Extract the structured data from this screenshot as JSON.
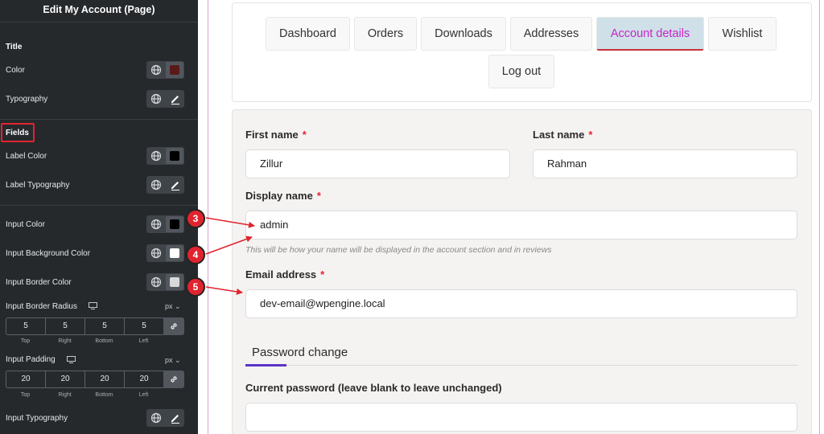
{
  "editor": {
    "title": "Edit My Account (Page)",
    "title_section": "Title",
    "title_color_label": "Color",
    "title_color": "#5a1a1a",
    "title_typography_label": "Typography",
    "fields_section": "Fields",
    "label_color_label": "Label Color",
    "label_color": "#000000",
    "label_typography_label": "Label Typography",
    "input_color_label": "Input Color",
    "input_color": "#000000",
    "input_bg_label": "Input Background Color",
    "input_bg_color": "#ffffff",
    "input_border_label": "Input Border Color",
    "input_border_color": "#d9d9d9",
    "radius": {
      "label": "Input Border Radius",
      "unit": "px",
      "values": [
        "5",
        "5",
        "5",
        "5"
      ],
      "captions": [
        "Top",
        "Right",
        "Bottom",
        "Left"
      ]
    },
    "padding": {
      "label": "Input Padding",
      "unit": "px",
      "values": [
        "20",
        "20",
        "20",
        "20"
      ],
      "captions": [
        "Top",
        "Right",
        "Bottom",
        "Left"
      ]
    },
    "input_typography_label": "Input Typography"
  },
  "tabs": [
    "Dashboard",
    "Orders",
    "Downloads",
    "Addresses",
    "Account details",
    "Wishlist",
    "Log out"
  ],
  "active_tab": "Account details",
  "form": {
    "first_name": {
      "label": "First name",
      "required": "*",
      "value": "Zillur"
    },
    "last_name": {
      "label": "Last name",
      "required": "*",
      "value": "Rahman"
    },
    "display_name": {
      "label": "Display name",
      "required": "*",
      "value": "admin",
      "hint": "This will be how your name will be displayed in the account section and in reviews"
    },
    "email": {
      "label": "Email address",
      "required": "*",
      "value": "dev-email@wpengine.local"
    },
    "password_section": "Password change",
    "current_password": {
      "label": "Current password (leave blank to leave unchanged)",
      "value": ""
    }
  },
  "markers": [
    "3",
    "4",
    "5"
  ],
  "colors": {
    "accent": "#c726c7",
    "marker": "#e0242f",
    "active_tab_bg": "#cfe0e8",
    "panel_bg": "#26292c"
  }
}
